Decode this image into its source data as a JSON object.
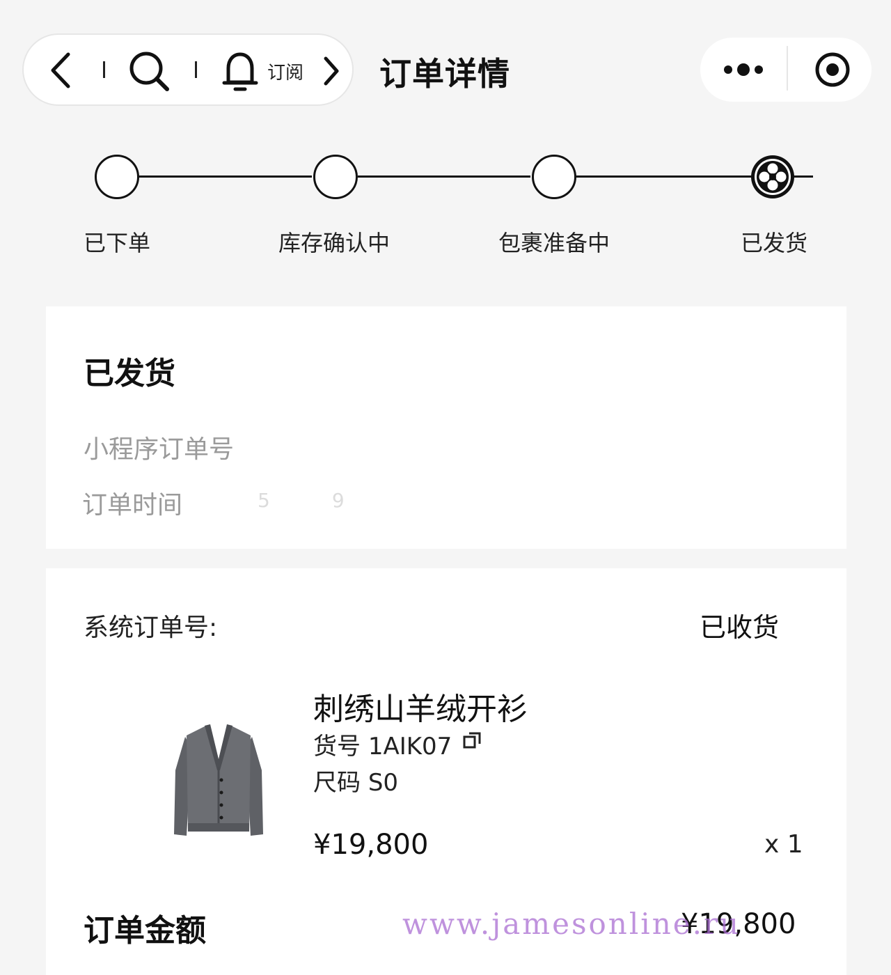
{
  "header": {
    "subscribe_label": "订阅",
    "title": "订单详情"
  },
  "progress": {
    "steps": [
      {
        "label": "已下单",
        "done": false
      },
      {
        "label": "库存确认中",
        "done": false
      },
      {
        "label": "包裹准备中",
        "done": false
      },
      {
        "label": "已发货",
        "done": true
      }
    ]
  },
  "status_card": {
    "title": "已发货",
    "mini_program_order_label": "小程序订单号",
    "order_time_label": "订单时间",
    "order_time_value_partial": "5          9"
  },
  "order_card": {
    "system_order_label": "系统订单号:",
    "status": "已收货",
    "product": {
      "name": "刺绣山羊绒开衫",
      "sku_label": "货号",
      "sku_value": "1AIK07",
      "size_label": "尺码",
      "size_value": "S0",
      "price": "¥19,800",
      "quantity": "x 1"
    },
    "total_label": "订单金额",
    "total_value": "¥19,800"
  },
  "watermark": "www.jamesonline.ru",
  "colors": {
    "accent": "#111111",
    "muted_text": "#9a9a9a",
    "watermark": "#b070d8"
  }
}
